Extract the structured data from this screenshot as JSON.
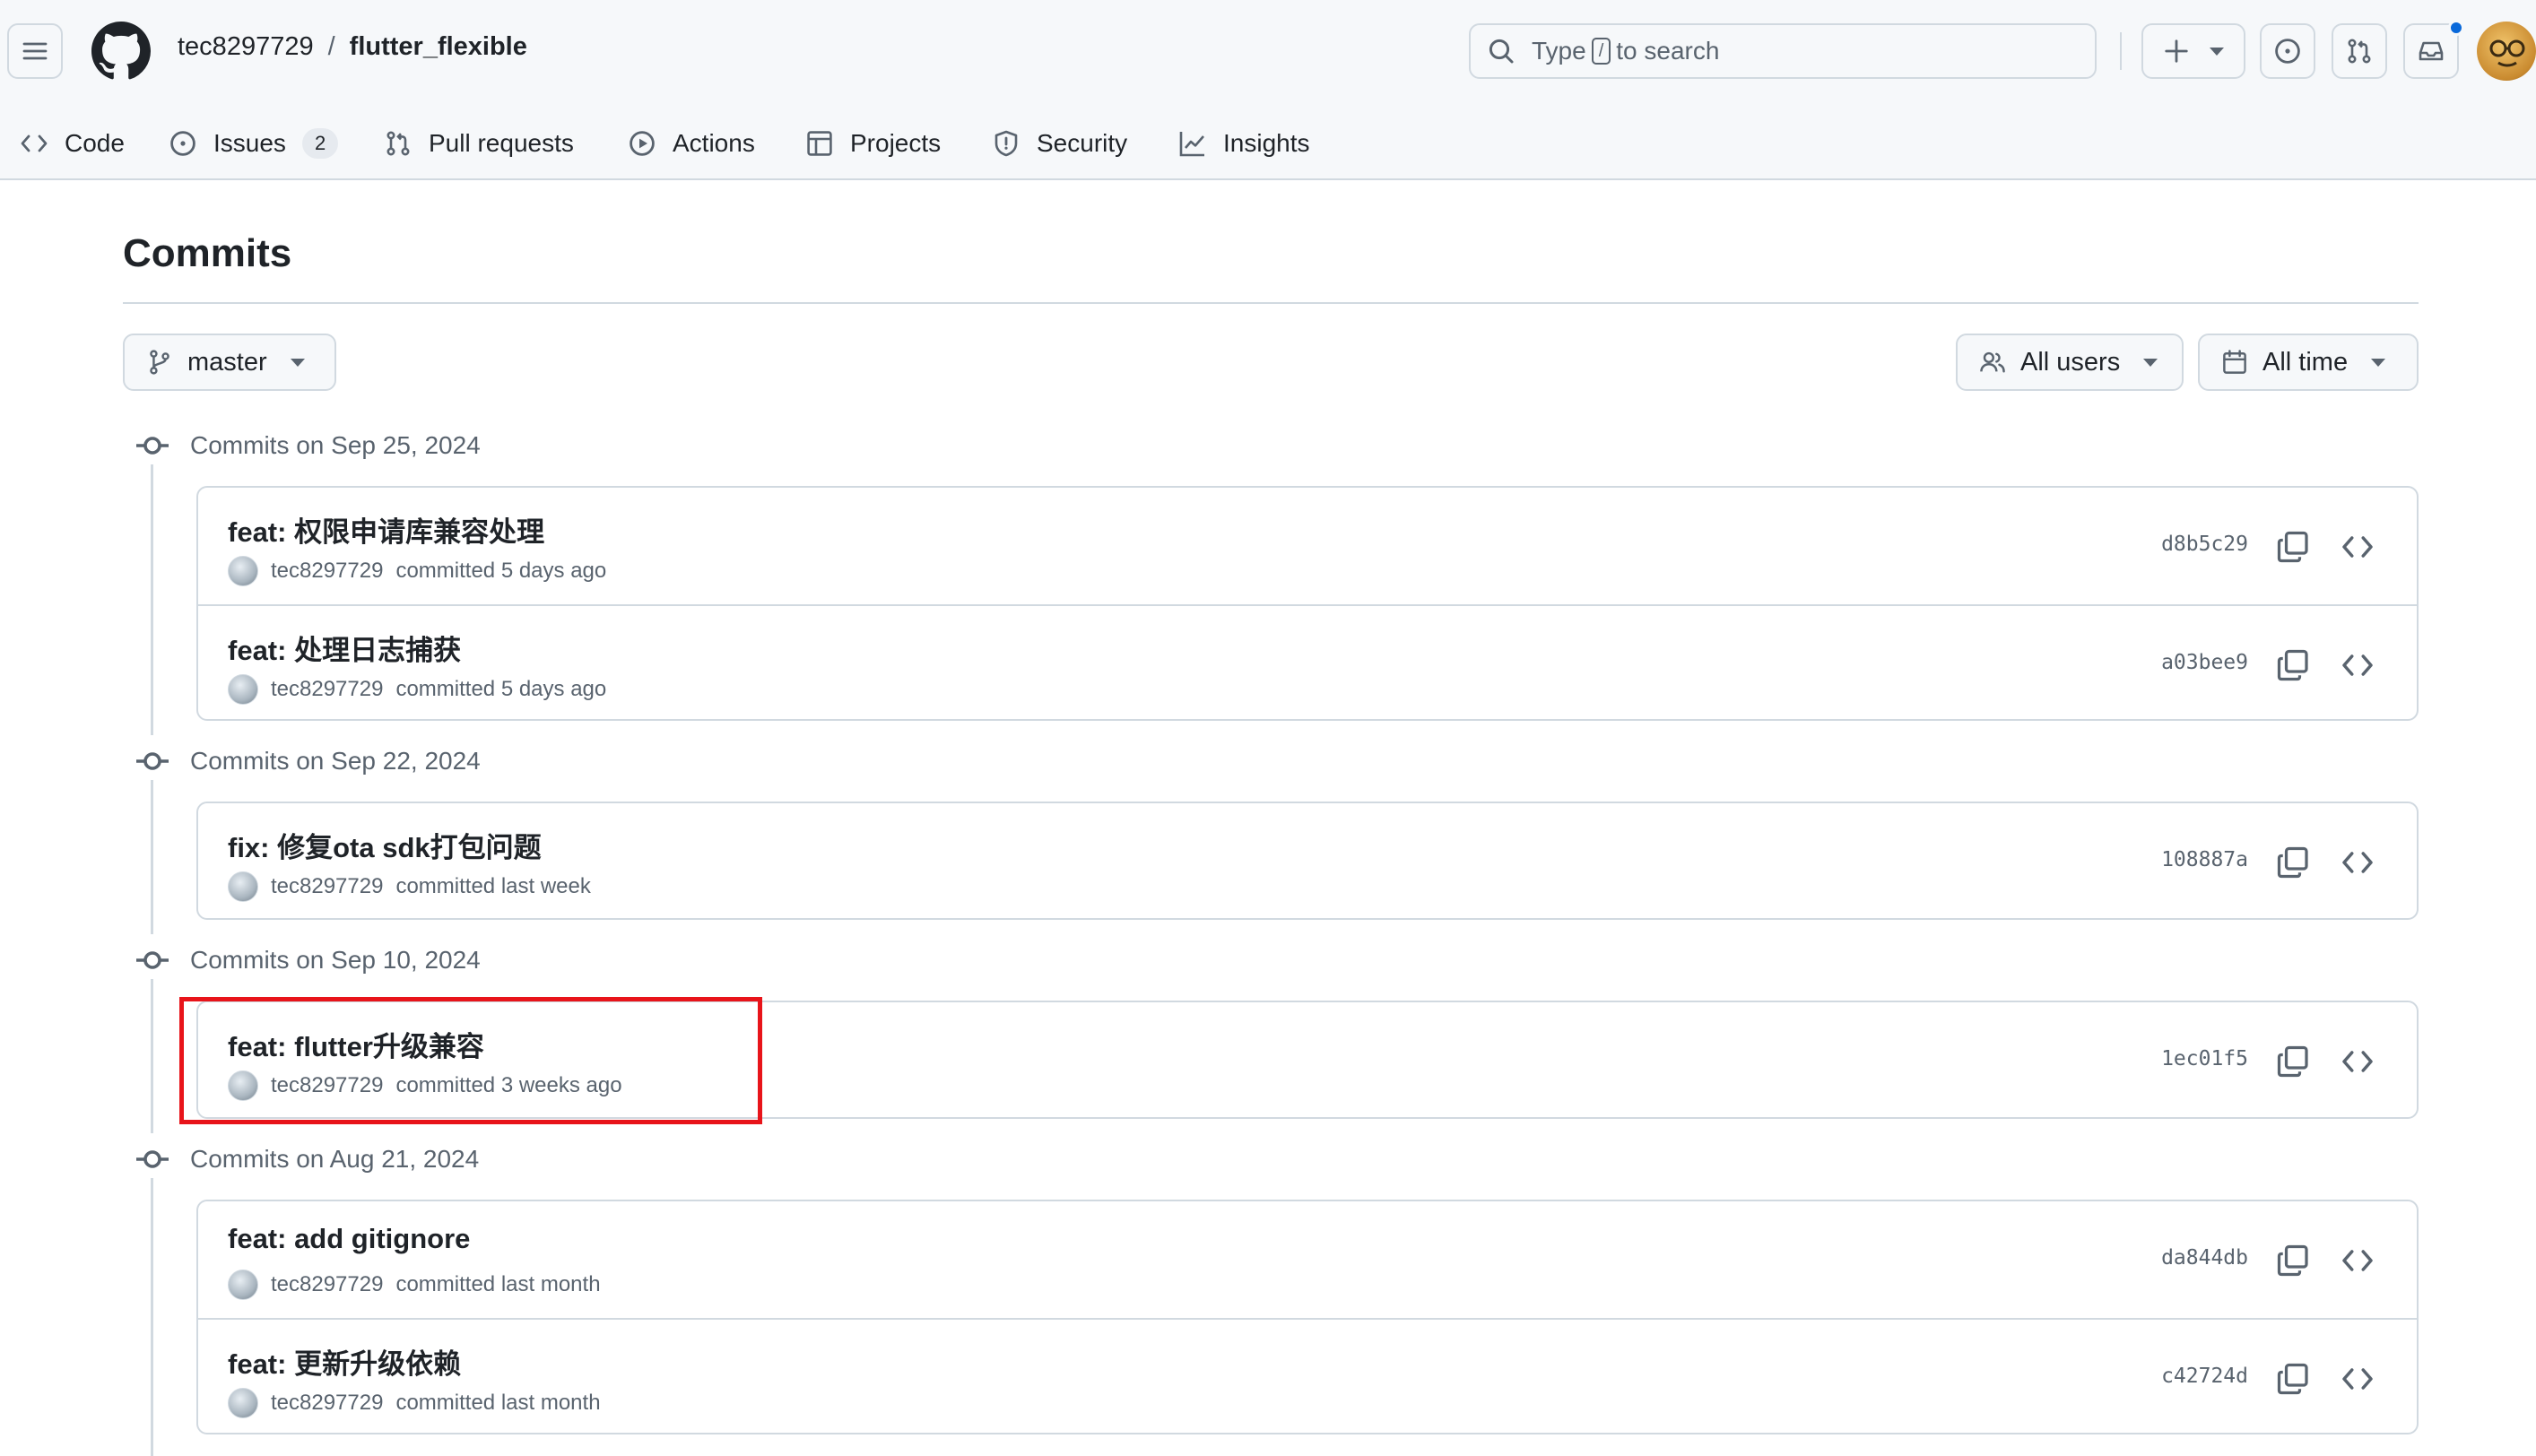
{
  "header": {
    "owner": "tec8297729",
    "separator": "/",
    "repo": "flutter_flexible",
    "search_prefix": "Type",
    "search_key": "/",
    "search_suffix": "to search"
  },
  "tabs": [
    {
      "label": "Code",
      "icon": "code-icon"
    },
    {
      "label": "Issues",
      "icon": "issue-opened-icon",
      "count": "2"
    },
    {
      "label": "Pull requests",
      "icon": "git-pull-request-icon"
    },
    {
      "label": "Actions",
      "icon": "play-icon"
    },
    {
      "label": "Projects",
      "icon": "table-icon"
    },
    {
      "label": "Security",
      "icon": "shield-icon"
    },
    {
      "label": "Insights",
      "icon": "graph-icon"
    }
  ],
  "main": {
    "title": "Commits",
    "branch": "master",
    "users_filter": "All users",
    "time_filter": "All time"
  },
  "groups": [
    {
      "date": "Commits on Sep 25, 2024",
      "commits": [
        {
          "message": "feat: 权限申请库兼容处理",
          "author": "tec8297729",
          "when": "committed 5 days ago",
          "sha": "d8b5c29"
        },
        {
          "message": "feat: 处理日志捕获",
          "author": "tec8297729",
          "when": "committed 5 days ago",
          "sha": "a03bee9"
        }
      ]
    },
    {
      "date": "Commits on Sep 22, 2024",
      "commits": [
        {
          "message": "fix: 修复ota sdk打包问题",
          "author": "tec8297729",
          "when": "committed last week",
          "sha": "108887a"
        }
      ]
    },
    {
      "date": "Commits on Sep 10, 2024",
      "commits": [
        {
          "message": "feat: flutter升级兼容",
          "author": "tec8297729",
          "when": "committed 3 weeks ago",
          "sha": "1ec01f5"
        }
      ]
    },
    {
      "date": "Commits on Aug 21, 2024",
      "commits": [
        {
          "message": "feat: add gitignore",
          "author": "tec8297729",
          "when": "committed last month",
          "sha": "da844db"
        },
        {
          "message": "feat: 更新升级依赖",
          "author": "tec8297729",
          "when": "committed last month",
          "sha": "c42724d"
        }
      ]
    }
  ],
  "colors": {
    "header_bg": "#f6f8fa",
    "border": "#d1d9e0",
    "muted": "#59636e",
    "accent_blue": "#0969da",
    "highlight_red": "#e8141a"
  }
}
